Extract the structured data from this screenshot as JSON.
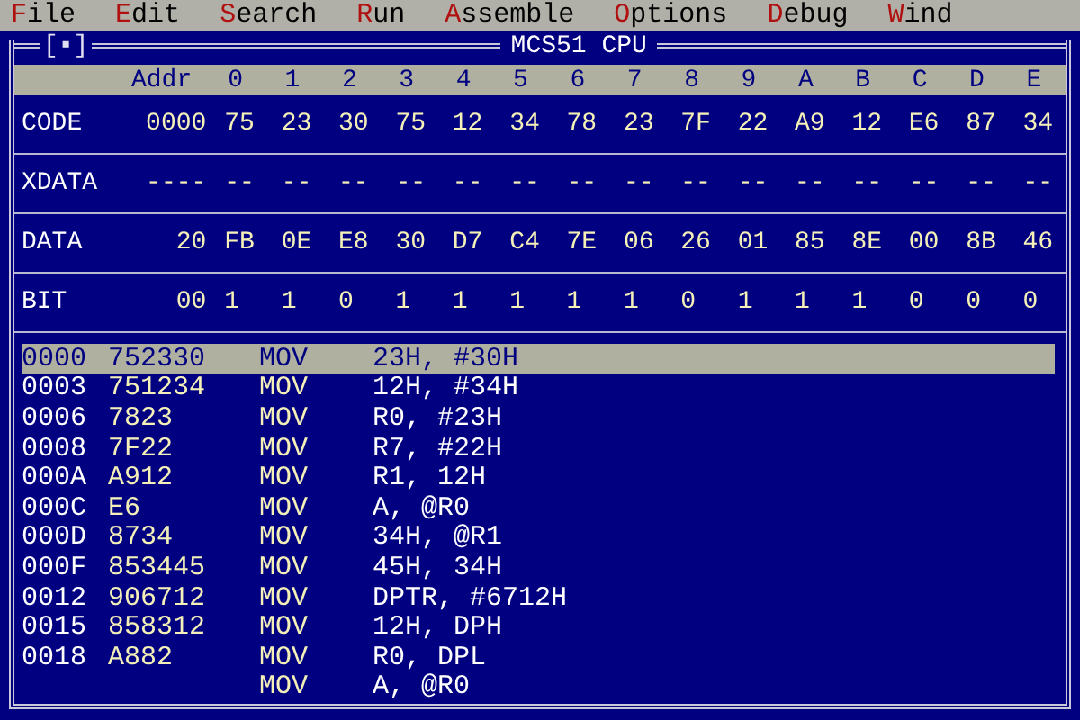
{
  "menu": [
    {
      "key": "F",
      "rest": "ile"
    },
    {
      "key": "E",
      "rest": "dit"
    },
    {
      "key": "S",
      "rest": "earch"
    },
    {
      "key": "R",
      "rest": "un"
    },
    {
      "key": "A",
      "rest": "ssemble"
    },
    {
      "key": "O",
      "rest": "ptions"
    },
    {
      "key": "D",
      "rest": "ebug"
    },
    {
      "key": "W",
      "rest": "ind"
    }
  ],
  "window": {
    "close_box": "[▪]",
    "title": "MCS51 CPU"
  },
  "header": {
    "addr": "Addr",
    "columns": [
      "0",
      "1",
      "2",
      "3",
      "4",
      "5",
      "6",
      "7",
      "8",
      "9",
      "A",
      "B",
      "C",
      "D",
      "E"
    ]
  },
  "memory": [
    {
      "label": "CODE",
      "addr": "0000",
      "values": [
        "75",
        "23",
        "30",
        "75",
        "12",
        "34",
        "78",
        "23",
        "7F",
        "22",
        "A9",
        "12",
        "E6",
        "87",
        "34"
      ]
    },
    {
      "label": "XDATA",
      "addr": "----",
      "values": [
        "--",
        "--",
        "--",
        "--",
        "--",
        "--",
        "--",
        "--",
        "--",
        "--",
        "--",
        "--",
        "--",
        "--",
        "--"
      ]
    },
    {
      "label": "DATA",
      "addr": "20",
      "values": [
        "FB",
        "0E",
        "E8",
        "30",
        "D7",
        "C4",
        "7E",
        "06",
        "26",
        "01",
        "85",
        "8E",
        "00",
        "8B",
        "46"
      ]
    },
    {
      "label": "BIT",
      "addr": "00",
      "values": [
        "1",
        "1",
        "0",
        "1",
        "1",
        "1",
        "1",
        "1",
        "0",
        "1",
        "1",
        "1",
        "0",
        "0",
        "0"
      ]
    }
  ],
  "disassembly": [
    {
      "addr": "0000",
      "bytes": "752330",
      "mnemonic": "MOV",
      "operands": "23H, #30H",
      "selected": true
    },
    {
      "addr": "0003",
      "bytes": "751234",
      "mnemonic": "MOV",
      "operands": "12H, #34H",
      "selected": false
    },
    {
      "addr": "0006",
      "bytes": "7823",
      "mnemonic": "MOV",
      "operands": "R0, #23H",
      "selected": false
    },
    {
      "addr": "0008",
      "bytes": "7F22",
      "mnemonic": "MOV",
      "operands": "R7, #22H",
      "selected": false
    },
    {
      "addr": "000A",
      "bytes": "A912",
      "mnemonic": "MOV",
      "operands": "R1, 12H",
      "selected": false
    },
    {
      "addr": "000C",
      "bytes": "E6",
      "mnemonic": "MOV",
      "operands": "A, @R0",
      "selected": false
    },
    {
      "addr": "000D",
      "bytes": "8734",
      "mnemonic": "MOV",
      "operands": "34H, @R1",
      "selected": false
    },
    {
      "addr": "000F",
      "bytes": "853445",
      "mnemonic": "MOV",
      "operands": "45H, 34H",
      "selected": false
    },
    {
      "addr": "0012",
      "bytes": "906712",
      "mnemonic": "MOV",
      "operands": "DPTR, #6712H",
      "selected": false
    },
    {
      "addr": "0015",
      "bytes": "858312",
      "mnemonic": "MOV",
      "operands": "12H, DPH",
      "selected": false
    },
    {
      "addr": "0018",
      "bytes": "A882",
      "mnemonic": "MOV",
      "operands": "R0, DPL",
      "selected": false
    },
    {
      "mnemonic": "MOV",
      "operands": "A, @R0",
      "selected": false
    }
  ]
}
